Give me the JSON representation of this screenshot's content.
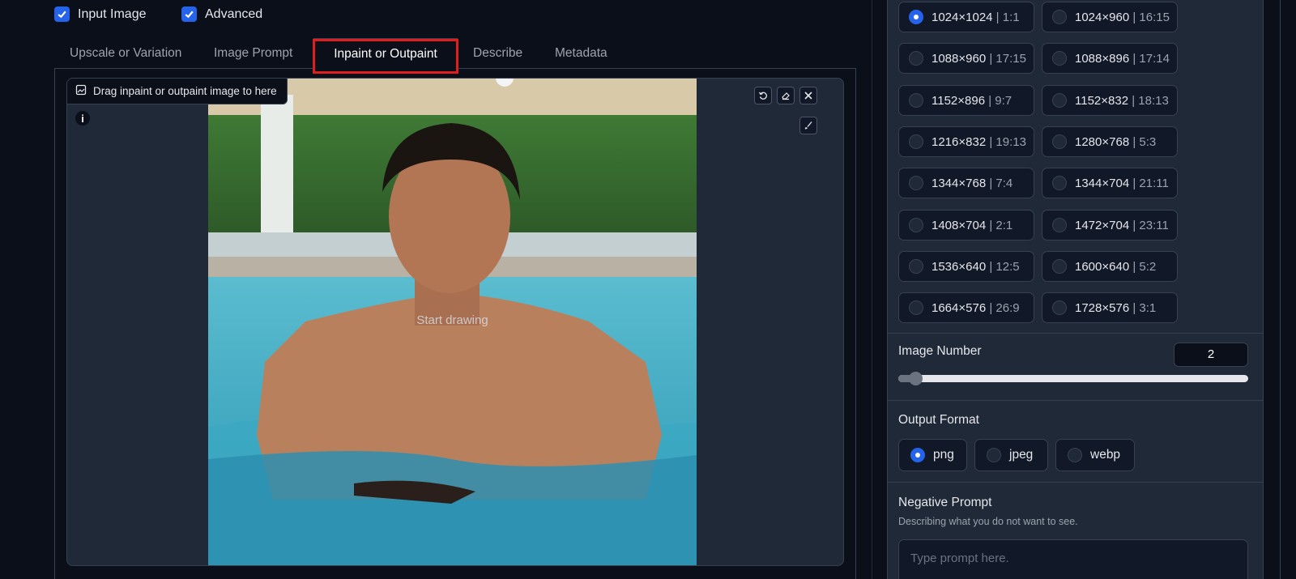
{
  "checkboxes": {
    "input_image": {
      "label": "Input Image",
      "checked": true
    },
    "advanced": {
      "label": "Advanced",
      "checked": true
    }
  },
  "tabs": [
    {
      "label": "Upscale or Variation",
      "active": false
    },
    {
      "label": "Image Prompt",
      "active": false
    },
    {
      "label": "Inpaint or Outpaint",
      "active": true
    },
    {
      "label": "Describe",
      "active": false
    },
    {
      "label": "Metadata",
      "active": false
    }
  ],
  "canvas": {
    "drop_label": "Drag inpaint or outpaint image to here",
    "overlay_text": "Start drawing",
    "icons": [
      "image-icon",
      "info-icon",
      "undo-icon",
      "eraser-icon",
      "close-icon",
      "brush-icon"
    ]
  },
  "resolutions": [
    {
      "size": "1024×1024",
      "ratio": "| 1:1",
      "selected": true
    },
    {
      "size": "1024×960",
      "ratio": "| 16:15",
      "selected": false
    },
    {
      "size": "1088×960",
      "ratio": "| 17:15",
      "selected": false
    },
    {
      "size": "1088×896",
      "ratio": "| 17:14",
      "selected": false
    },
    {
      "size": "1152×896",
      "ratio": "| 9:7",
      "selected": false
    },
    {
      "size": "1152×832",
      "ratio": "| 18:13",
      "selected": false
    },
    {
      "size": "1216×832",
      "ratio": "| 19:13",
      "selected": false
    },
    {
      "size": "1280×768",
      "ratio": "| 5:3",
      "selected": false
    },
    {
      "size": "1344×768",
      "ratio": "| 7:4",
      "selected": false
    },
    {
      "size": "1344×704",
      "ratio": "| 21:11",
      "selected": false
    },
    {
      "size": "1408×704",
      "ratio": "| 2:1",
      "selected": false
    },
    {
      "size": "1472×704",
      "ratio": "| 23:11",
      "selected": false
    },
    {
      "size": "1536×640",
      "ratio": "| 12:5",
      "selected": false
    },
    {
      "size": "1600×640",
      "ratio": "| 5:2",
      "selected": false
    },
    {
      "size": "1664×576",
      "ratio": "| 26:9",
      "selected": false
    },
    {
      "size": "1728×576",
      "ratio": "| 3:1",
      "selected": false
    }
  ],
  "image_number": {
    "label": "Image Number",
    "value": "2",
    "slider_fraction": 0.03
  },
  "output_format": {
    "label": "Output Format",
    "options": [
      {
        "label": "png",
        "selected": true
      },
      {
        "label": "jpeg",
        "selected": false
      },
      {
        "label": "webp",
        "selected": false
      }
    ]
  },
  "negative_prompt": {
    "label": "Negative Prompt",
    "description": "Describing what you do not want to see.",
    "placeholder": "Type prompt here."
  },
  "colors": {
    "accent": "#2563eb",
    "highlight": "#e11d1d",
    "background": "#0b0f19",
    "panel": "#1f2937"
  }
}
